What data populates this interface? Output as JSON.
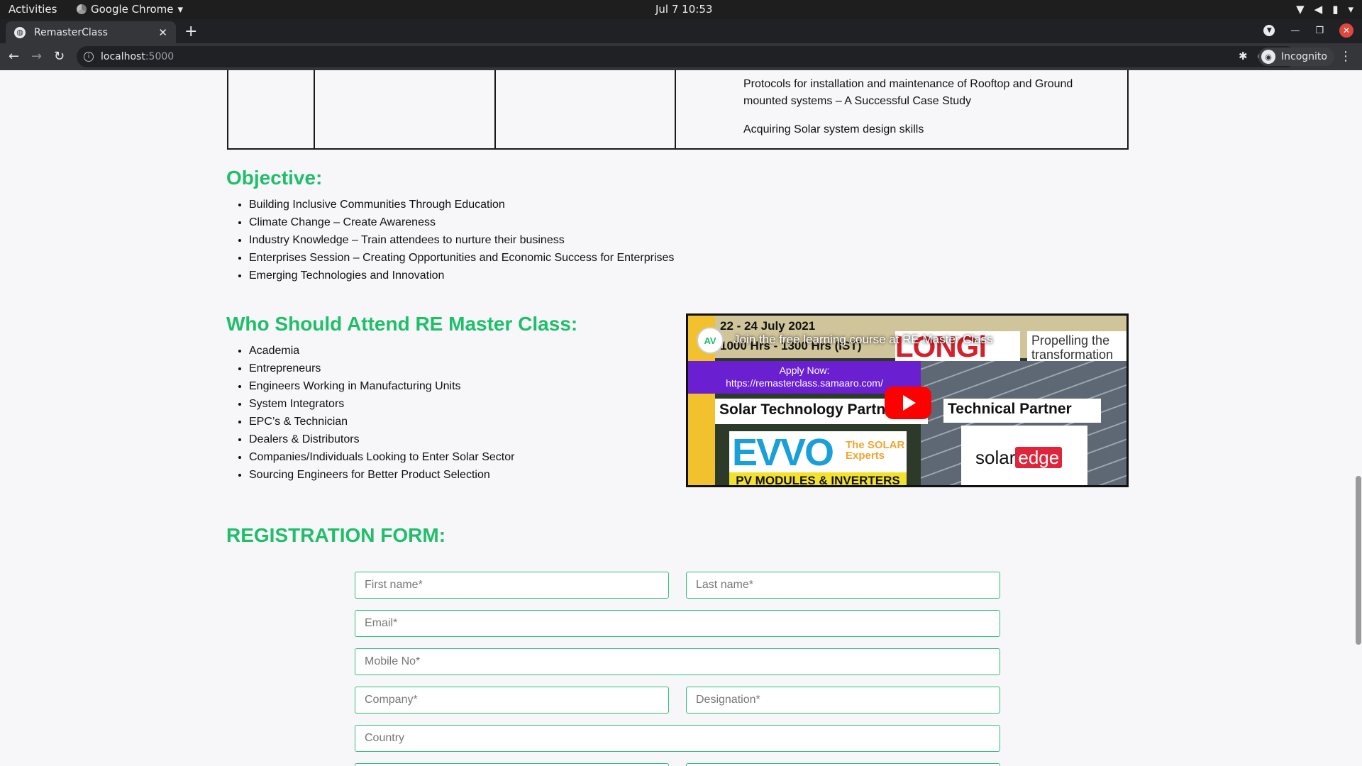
{
  "system": {
    "activities": "Activities",
    "app_name": "Google Chrome",
    "clock": "Jul 7  10:53"
  },
  "browser": {
    "tab_title": "RemasterClass",
    "url_host": "localhost",
    "url_port": ":5000",
    "profile_label": "Incognito"
  },
  "schedule_table": {
    "topics": [
      "Protocols for installation and maintenance of Rooftop and Ground mounted systems – A Successful Case Study",
      "Acquiring Solar system design skills"
    ]
  },
  "objective": {
    "heading": "Objective:",
    "items": [
      "Building Inclusive Communities Through Education",
      "Climate Change – Create Awareness",
      "Industry Knowledge – Train attendees to nurture their business",
      "Enterprises Session – Creating Opportunities and Economic Success for Enterprises",
      "Emerging Technologies and Innovation"
    ]
  },
  "attend": {
    "heading": "Who Should Attend RE Master Class:",
    "items": [
      "Academia",
      "Entrepreneurs",
      "Engineers Working in Manufacturing Units",
      "System Integrators",
      "EPC’s & Technician",
      "Dealers & Distributors",
      "Companies/Individuals Looking to Enter Solar Sector",
      "Sourcing Engineers for Better Product Selection"
    ]
  },
  "video": {
    "title": "Join the free learning course at RE Master Class",
    "date": "22 - 24 July 2021",
    "hours": "1000 Hrs - 1300 Hrs (IST)",
    "apply_line1": "Apply Now:",
    "apply_line2": "https://remasterclass.samaaro.com/",
    "sponsor1": "LONGi",
    "sponsor1_tagline": "Propelling the transformation",
    "partner_label1": "Solar Technology Partner",
    "partner_label2": "Technical Partner",
    "evvo": "EVVO",
    "evvo_tagline": "The SOLAR Experts",
    "evvo_banner": "PV MODULES & INVERTERS",
    "solaredge_prefix": "solar",
    "solaredge_suffix": "edge"
  },
  "registration": {
    "heading": "REGISTRATION FORM:",
    "first_name": "First name*",
    "last_name": "Last name*",
    "email": "Email*",
    "mobile": "Mobile No*",
    "company": "Company*",
    "designation": "Designation*",
    "country": "Country"
  },
  "colors": {
    "accent_green": "#1fbf6a",
    "field_border": "#2fbf7a"
  }
}
